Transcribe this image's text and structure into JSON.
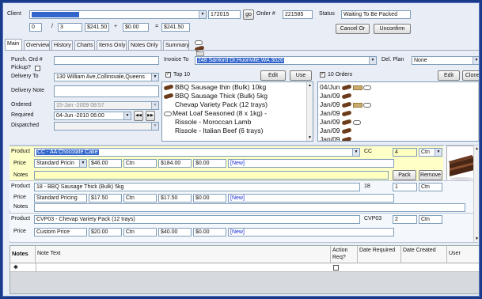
{
  "header": {
    "client_label": "Client",
    "client_value": "",
    "client_code": "172015",
    "go_label": "go",
    "order_label": "Order #",
    "order_number": "221585",
    "status_label": "Status",
    "status_value": "Waiting To Be Packed",
    "counter_a": "0",
    "counter_sep": "/",
    "counter_b": "3",
    "amount_1": "$241.50",
    "op_1": "+",
    "amount_2": "$0.00",
    "op_2": "=",
    "amount_3": "$241.50",
    "cancel_label": "Cancel Or",
    "unconfirm_label": "Unconfirm"
  },
  "tabs": [
    {
      "label": "Main"
    },
    {
      "label": "Overview"
    },
    {
      "label": "History"
    },
    {
      "label": "Charts"
    },
    {
      "label": "Items Only"
    },
    {
      "label": "Notes Only"
    },
    {
      "label": "Summary"
    }
  ],
  "form": {
    "purch_label": "Purch. Ord #",
    "pickup_label": "Pickup?",
    "delivery_to_label": "Delivery To",
    "delivery_to_value": "130 William Ave,Collinsvale,Queens",
    "delivery_note_label": "Delivery Note",
    "ordered_label": "Ordered",
    "ordered_value": "15-Jan -2009 08:57",
    "required_label": "Required",
    "required_value": "04-Jun -2010 06:00",
    "dispatched_label": "Dispatched",
    "invoice_to_label": "Invoice To",
    "invoice_to_value": "248 Sanford Dr,Huonville,WA 3026",
    "del_plan_label": "Del. Plan",
    "del_plan_value": "None",
    "top10_label": "Top 10",
    "top10_edit": "Edit",
    "top10_use": "Use",
    "orders10_label": "10 Orders",
    "orders10_edit": "Edit",
    "orders10_clone": "Clone"
  },
  "top10_items": [
    {
      "icon": "sausage-icon",
      "label": "BBQ Sausage thin (Bulk) 10kg"
    },
    {
      "icon": "sausage-icon",
      "label": "BBQ Sausage Thick (Bulk) 5kg"
    },
    {
      "icon": "none",
      "label": "Chevap Variety Pack (12 trays)"
    },
    {
      "icon": "meat-icon",
      "label": "Meat Loaf Seasoned (8 x 1kg) -"
    },
    {
      "icon": "none",
      "label": "Rissole - Moroccan Lamb"
    },
    {
      "icon": "none",
      "label": "Rissole - Italian Beef (6 trays)"
    }
  ],
  "orders10_items": [
    {
      "label": "04/Jun"
    },
    {
      "label": "Jan/09"
    },
    {
      "label": "Jan/09"
    },
    {
      "label": "Jan/09"
    },
    {
      "label": "Jan/09"
    },
    {
      "label": "Jan/09"
    },
    {
      "label": "Jan/09"
    }
  ],
  "products": [
    {
      "product_label": "Product",
      "product_value": "CC - AA Chocolate Cake",
      "code": "CC",
      "qty": "4",
      "unit": "Ctn",
      "price_label": "Price",
      "pricing": "Standard Pricin",
      "unit_price": "$46.00",
      "per": "Ctn",
      "total": "$184.00",
      "extra": "$0.00",
      "tag": "[New]",
      "notes_label": "Notes",
      "pack_label": "Pack",
      "remove_label": "Remove"
    },
    {
      "product_label": "Product",
      "product_value": "18 - BBQ Sausage Thick (Bulk) 5kg",
      "code": "18",
      "qty": "1",
      "unit": "Ctn",
      "price_label": "Price",
      "pricing": "Standard Pricing",
      "unit_price": "$17.50",
      "per": "Ctn",
      "total": "$17.50",
      "extra": "$0.00",
      "tag": "[New]",
      "notes_label": "Notes"
    },
    {
      "product_label": "Product",
      "product_value": "CVP03 - Chevap Variety Pack (12 trays)",
      "code": "CVP03",
      "qty": "2",
      "unit": "Ctn",
      "price_label": "Price",
      "pricing": "Custom Price",
      "unit_price": "$20.00",
      "per": "Ctn",
      "total": "$40.00",
      "extra": "$0.00",
      "tag": "[New]"
    }
  ],
  "notes_grid": {
    "notes_label": "Notes",
    "headers": [
      "Note Text",
      "Action Req?",
      "Date Required",
      "Date Created",
      "User"
    ],
    "new_row_marker": "✱"
  },
  "colors": {
    "frame": "#1a3a8a",
    "panel": "#e9eef6",
    "selected_row": "#ffffc8",
    "link_new": "#1a2fd0"
  }
}
